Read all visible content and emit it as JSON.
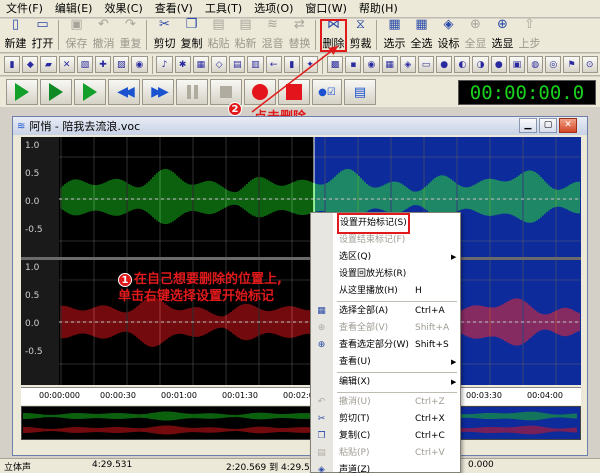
{
  "menu": [
    "文件(F)",
    "编辑(E)",
    "效果(C)",
    "查看(V)",
    "工具(T)",
    "选项(O)",
    "窗口(W)",
    "帮助(H)"
  ],
  "toolbar1": [
    {
      "label": "新建",
      "icon": "new-file-icon",
      "glyph": "▯",
      "disabled": false
    },
    {
      "label": "打开",
      "icon": "open-folder-icon",
      "glyph": "▭",
      "disabled": false
    },
    {
      "label": "保存",
      "icon": "save-icon",
      "glyph": "▣",
      "disabled": true
    },
    {
      "label": "撤消",
      "icon": "undo-icon",
      "glyph": "↶",
      "disabled": true
    },
    {
      "label": "重复",
      "icon": "redo-icon",
      "glyph": "↷",
      "disabled": true
    },
    {
      "label": "剪切",
      "icon": "cut-icon",
      "glyph": "✂",
      "disabled": false
    },
    {
      "label": "复制",
      "icon": "copy-icon",
      "glyph": "❐",
      "disabled": false
    },
    {
      "label": "粘贴",
      "icon": "paste-icon",
      "glyph": "▤",
      "disabled": true
    },
    {
      "label": "粘新",
      "icon": "paste-new-icon",
      "glyph": "▤",
      "disabled": true
    },
    {
      "label": "混音",
      "icon": "mix-icon",
      "glyph": "≋",
      "disabled": true
    },
    {
      "label": "替换",
      "icon": "replace-icon",
      "glyph": "⇄",
      "disabled": true
    },
    {
      "label": "删除",
      "icon": "delete-icon",
      "glyph": "⋈",
      "disabled": false,
      "highlight": true
    },
    {
      "label": "剪裁",
      "icon": "trim-icon",
      "glyph": "⧖",
      "disabled": false
    },
    {
      "label": "选示",
      "icon": "view-selection-icon",
      "glyph": "▦",
      "disabled": false
    },
    {
      "label": "全选",
      "icon": "select-all-icon",
      "glyph": "▦",
      "disabled": false
    },
    {
      "label": "设标",
      "icon": "set-marker-icon",
      "glyph": "◈",
      "disabled": false
    },
    {
      "label": "全显",
      "icon": "zoom-all-icon",
      "glyph": "⊕",
      "disabled": true
    },
    {
      "label": "选显",
      "icon": "zoom-selection-icon",
      "glyph": "⊕",
      "disabled": false
    },
    {
      "label": "上步",
      "icon": "previous-step-icon",
      "glyph": "⇧",
      "disabled": true
    }
  ],
  "time_display": "00:00:00.0",
  "annotation2": {
    "num": "2",
    "text": "点击删除"
  },
  "document": {
    "title": "阿悄 - 陪我去流浪.voc"
  },
  "y_labels": [
    "1.0",
    "0.5",
    "0.0",
    "-0.5",
    "1.0",
    "0.5",
    "0.0",
    "-0.5"
  ],
  "ruler_labels": [
    "00:00:000",
    "00:00:30",
    "00:01:00",
    "00:01:30",
    "00:02:00",
    "00:02:30",
    "00:03:00",
    "00:03:30",
    "00:04:00"
  ],
  "status": {
    "left": "立体声",
    "pos": "4:29.531",
    "sel": "2:20.569 到 4:29.531",
    "val": "0.000"
  },
  "context_menu": [
    {
      "label": "设置开始标记(S)",
      "shortcut": "",
      "arrow": false,
      "disabled": false,
      "highlight": true,
      "icon": ""
    },
    {
      "label": "设置结束标记(F)",
      "shortcut": "",
      "arrow": false,
      "disabled": true,
      "highlight": false,
      "icon": ""
    },
    {
      "label": "选区(Q)",
      "shortcut": "",
      "arrow": true,
      "disabled": false,
      "highlight": false,
      "icon": ""
    },
    {
      "label": "设置回放光标(R)",
      "shortcut": "",
      "arrow": false,
      "disabled": false,
      "highlight": false,
      "icon": ""
    },
    {
      "label": "从这里播放(H)",
      "shortcut": "H",
      "arrow": false,
      "disabled": false,
      "highlight": false,
      "icon": ""
    },
    {
      "label": "选择全部(A)",
      "shortcut": "Ctrl+A",
      "arrow": false,
      "disabled": false,
      "highlight": false,
      "icon": "select-all-icon"
    },
    {
      "label": "查看全部(V)",
      "shortcut": "Shift+A",
      "arrow": false,
      "disabled": true,
      "highlight": false,
      "icon": "zoom-all-icon"
    },
    {
      "label": "查看选定部分(W)",
      "shortcut": "Shift+S",
      "arrow": false,
      "disabled": false,
      "highlight": false,
      "icon": "zoom-selection-icon"
    },
    {
      "label": "查看(U)",
      "shortcut": "",
      "arrow": true,
      "disabled": false,
      "highlight": false,
      "icon": ""
    },
    {
      "label": "编辑(X)",
      "shortcut": "",
      "arrow": true,
      "disabled": false,
      "highlight": false,
      "icon": ""
    },
    {
      "label": "撤消(U)",
      "shortcut": "Ctrl+Z",
      "arrow": false,
      "disabled": true,
      "highlight": false,
      "icon": "undo-icon"
    },
    {
      "label": "剪切(T)",
      "shortcut": "Ctrl+X",
      "arrow": false,
      "disabled": false,
      "highlight": false,
      "icon": "cut-icon"
    },
    {
      "label": "复制(C)",
      "shortcut": "Ctrl+C",
      "arrow": false,
      "disabled": false,
      "highlight": false,
      "icon": "copy-icon"
    },
    {
      "label": "粘贴(P)",
      "shortcut": "Ctrl+V",
      "arrow": false,
      "disabled": true,
      "highlight": false,
      "icon": "paste-icon"
    },
    {
      "label": "声道(Z)",
      "shortcut": "",
      "arrow": false,
      "disabled": false,
      "highlight": false,
      "icon": "channel-icon"
    }
  ],
  "annotation1": {
    "num": "1",
    "line1": "在自己想要删除的位置上,",
    "line2": "单击右键选择设置开始标记"
  },
  "colors": {
    "wave_left": "#19c21d",
    "wave_right": "#e3141b",
    "selection": "#0d2b9a",
    "annotation": "#e0191b"
  }
}
